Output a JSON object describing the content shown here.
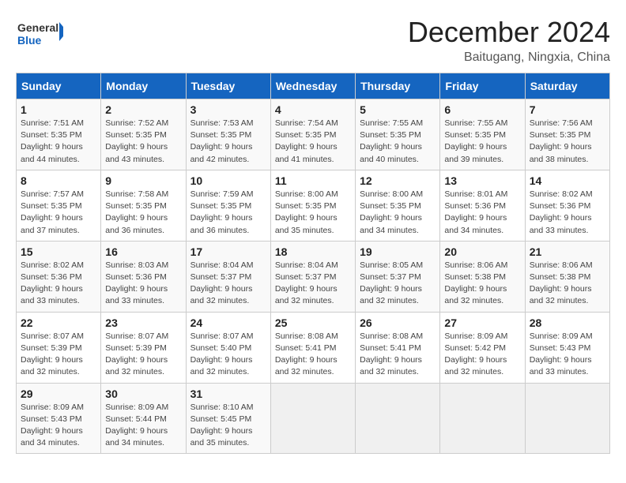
{
  "logo": {
    "general": "General",
    "blue": "Blue"
  },
  "header": {
    "month": "December 2024",
    "location": "Baitugang, Ningxia, China"
  },
  "weekdays": [
    "Sunday",
    "Monday",
    "Tuesday",
    "Wednesday",
    "Thursday",
    "Friday",
    "Saturday"
  ],
  "weeks": [
    [
      {
        "day": "1",
        "sunrise": "Sunrise: 7:51 AM",
        "sunset": "Sunset: 5:35 PM",
        "daylight": "Daylight: 9 hours and 44 minutes."
      },
      {
        "day": "2",
        "sunrise": "Sunrise: 7:52 AM",
        "sunset": "Sunset: 5:35 PM",
        "daylight": "Daylight: 9 hours and 43 minutes."
      },
      {
        "day": "3",
        "sunrise": "Sunrise: 7:53 AM",
        "sunset": "Sunset: 5:35 PM",
        "daylight": "Daylight: 9 hours and 42 minutes."
      },
      {
        "day": "4",
        "sunrise": "Sunrise: 7:54 AM",
        "sunset": "Sunset: 5:35 PM",
        "daylight": "Daylight: 9 hours and 41 minutes."
      },
      {
        "day": "5",
        "sunrise": "Sunrise: 7:55 AM",
        "sunset": "Sunset: 5:35 PM",
        "daylight": "Daylight: 9 hours and 40 minutes."
      },
      {
        "day": "6",
        "sunrise": "Sunrise: 7:55 AM",
        "sunset": "Sunset: 5:35 PM",
        "daylight": "Daylight: 9 hours and 39 minutes."
      },
      {
        "day": "7",
        "sunrise": "Sunrise: 7:56 AM",
        "sunset": "Sunset: 5:35 PM",
        "daylight": "Daylight: 9 hours and 38 minutes."
      }
    ],
    [
      {
        "day": "8",
        "sunrise": "Sunrise: 7:57 AM",
        "sunset": "Sunset: 5:35 PM",
        "daylight": "Daylight: 9 hours and 37 minutes."
      },
      {
        "day": "9",
        "sunrise": "Sunrise: 7:58 AM",
        "sunset": "Sunset: 5:35 PM",
        "daylight": "Daylight: 9 hours and 36 minutes."
      },
      {
        "day": "10",
        "sunrise": "Sunrise: 7:59 AM",
        "sunset": "Sunset: 5:35 PM",
        "daylight": "Daylight: 9 hours and 36 minutes."
      },
      {
        "day": "11",
        "sunrise": "Sunrise: 8:00 AM",
        "sunset": "Sunset: 5:35 PM",
        "daylight": "Daylight: 9 hours and 35 minutes."
      },
      {
        "day": "12",
        "sunrise": "Sunrise: 8:00 AM",
        "sunset": "Sunset: 5:35 PM",
        "daylight": "Daylight: 9 hours and 34 minutes."
      },
      {
        "day": "13",
        "sunrise": "Sunrise: 8:01 AM",
        "sunset": "Sunset: 5:36 PM",
        "daylight": "Daylight: 9 hours and 34 minutes."
      },
      {
        "day": "14",
        "sunrise": "Sunrise: 8:02 AM",
        "sunset": "Sunset: 5:36 PM",
        "daylight": "Daylight: 9 hours and 33 minutes."
      }
    ],
    [
      {
        "day": "15",
        "sunrise": "Sunrise: 8:02 AM",
        "sunset": "Sunset: 5:36 PM",
        "daylight": "Daylight: 9 hours and 33 minutes."
      },
      {
        "day": "16",
        "sunrise": "Sunrise: 8:03 AM",
        "sunset": "Sunset: 5:36 PM",
        "daylight": "Daylight: 9 hours and 33 minutes."
      },
      {
        "day": "17",
        "sunrise": "Sunrise: 8:04 AM",
        "sunset": "Sunset: 5:37 PM",
        "daylight": "Daylight: 9 hours and 32 minutes."
      },
      {
        "day": "18",
        "sunrise": "Sunrise: 8:04 AM",
        "sunset": "Sunset: 5:37 PM",
        "daylight": "Daylight: 9 hours and 32 minutes."
      },
      {
        "day": "19",
        "sunrise": "Sunrise: 8:05 AM",
        "sunset": "Sunset: 5:37 PM",
        "daylight": "Daylight: 9 hours and 32 minutes."
      },
      {
        "day": "20",
        "sunrise": "Sunrise: 8:06 AM",
        "sunset": "Sunset: 5:38 PM",
        "daylight": "Daylight: 9 hours and 32 minutes."
      },
      {
        "day": "21",
        "sunrise": "Sunrise: 8:06 AM",
        "sunset": "Sunset: 5:38 PM",
        "daylight": "Daylight: 9 hours and 32 minutes."
      }
    ],
    [
      {
        "day": "22",
        "sunrise": "Sunrise: 8:07 AM",
        "sunset": "Sunset: 5:39 PM",
        "daylight": "Daylight: 9 hours and 32 minutes."
      },
      {
        "day": "23",
        "sunrise": "Sunrise: 8:07 AM",
        "sunset": "Sunset: 5:39 PM",
        "daylight": "Daylight: 9 hours and 32 minutes."
      },
      {
        "day": "24",
        "sunrise": "Sunrise: 8:07 AM",
        "sunset": "Sunset: 5:40 PM",
        "daylight": "Daylight: 9 hours and 32 minutes."
      },
      {
        "day": "25",
        "sunrise": "Sunrise: 8:08 AM",
        "sunset": "Sunset: 5:41 PM",
        "daylight": "Daylight: 9 hours and 32 minutes."
      },
      {
        "day": "26",
        "sunrise": "Sunrise: 8:08 AM",
        "sunset": "Sunset: 5:41 PM",
        "daylight": "Daylight: 9 hours and 32 minutes."
      },
      {
        "day": "27",
        "sunrise": "Sunrise: 8:09 AM",
        "sunset": "Sunset: 5:42 PM",
        "daylight": "Daylight: 9 hours and 32 minutes."
      },
      {
        "day": "28",
        "sunrise": "Sunrise: 8:09 AM",
        "sunset": "Sunset: 5:43 PM",
        "daylight": "Daylight: 9 hours and 33 minutes."
      }
    ],
    [
      {
        "day": "29",
        "sunrise": "Sunrise: 8:09 AM",
        "sunset": "Sunset: 5:43 PM",
        "daylight": "Daylight: 9 hours and 34 minutes."
      },
      {
        "day": "30",
        "sunrise": "Sunrise: 8:09 AM",
        "sunset": "Sunset: 5:44 PM",
        "daylight": "Daylight: 9 hours and 34 minutes."
      },
      {
        "day": "31",
        "sunrise": "Sunrise: 8:10 AM",
        "sunset": "Sunset: 5:45 PM",
        "daylight": "Daylight: 9 hours and 35 minutes."
      },
      null,
      null,
      null,
      null
    ]
  ]
}
